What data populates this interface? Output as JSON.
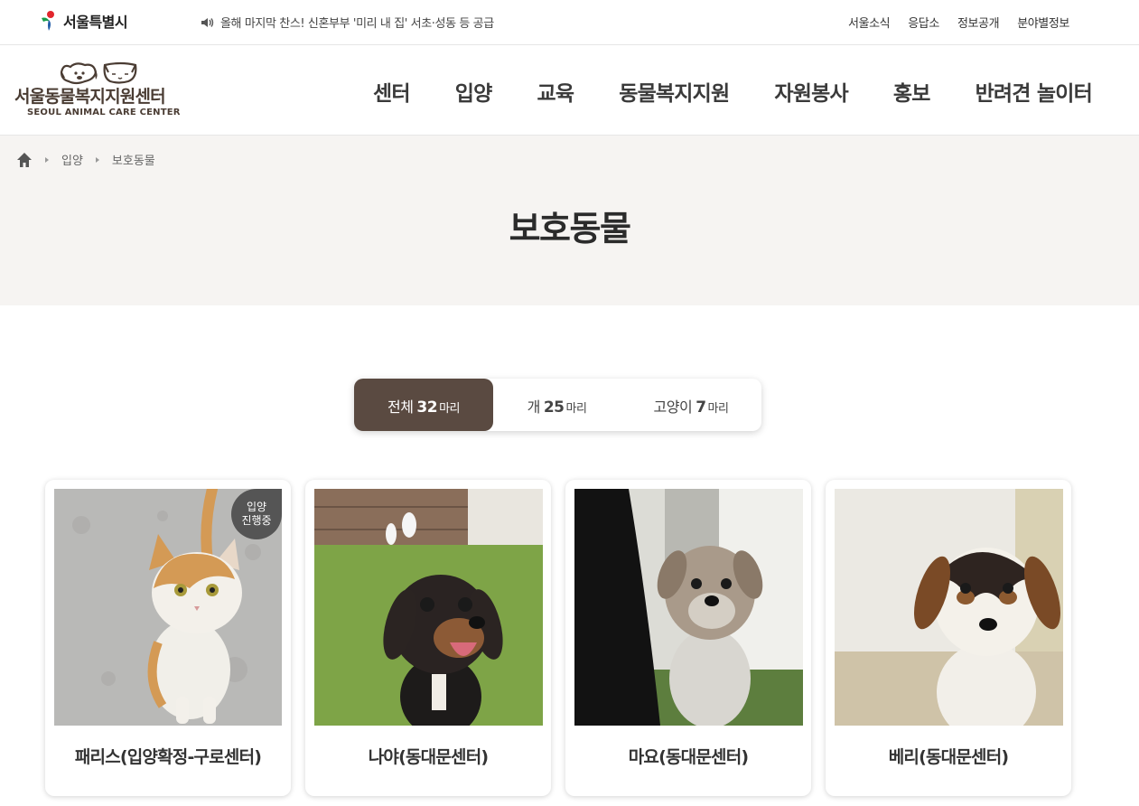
{
  "topbar": {
    "seoul_logo_text": "서울특별시",
    "notice": "올해 마지막 찬스! 신혼부부 '미리 내 집' 서초·성동 등 공급",
    "links": [
      "서울소식",
      "응답소",
      "정보공개",
      "분야별정보"
    ]
  },
  "header": {
    "brand_name": "서울동물복지지원센터",
    "brand_en": "SEOUL ANIMAL CARE CENTER",
    "nav": [
      "센터",
      "입양",
      "교육",
      "동물복지지원",
      "자원봉사",
      "홍보",
      "반려견 놀이터"
    ]
  },
  "breadcrumb": [
    "입양",
    "보호동물"
  ],
  "page_title": "보호동물",
  "tabs": [
    {
      "label": "전체",
      "count": "32",
      "unit": "마리",
      "active": true
    },
    {
      "label": "개",
      "count": "25",
      "unit": "마리",
      "active": false
    },
    {
      "label": "고양이",
      "count": "7",
      "unit": "마리",
      "active": false
    }
  ],
  "cards": [
    {
      "name": "패리스(입양확정-구로센터)",
      "badge": "입양\n진행중",
      "badge_line1": "입양",
      "badge_line2": "진행중",
      "photo": "cat-icon"
    },
    {
      "name": "나야(동대문센터)",
      "photo": "dog-icon"
    },
    {
      "name": "마요(동대문센터)",
      "photo": "dog-icon"
    },
    {
      "name": "베리(동대문센터)",
      "photo": "dog-icon"
    }
  ],
  "colors": {
    "accent": "#5a4a41",
    "hero_bg": "#f6f4f2",
    "badge": "#555555"
  }
}
